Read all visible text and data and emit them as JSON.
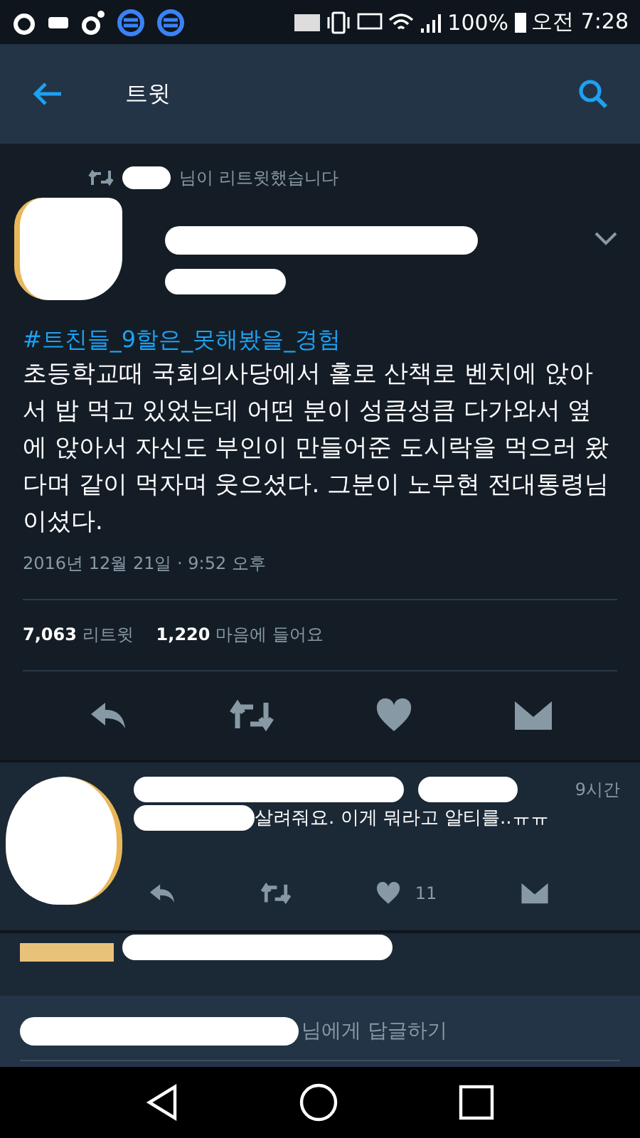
{
  "status_bar": {
    "battery": "100%",
    "time": "오전 7:28"
  },
  "header": {
    "title": "트윗"
  },
  "retweet_notice": "님이 리트윗했습니다",
  "tweet": {
    "hashtag": "#트친들_9할은_못해봤을_경험",
    "text": "초등학교때  국회의사당에서  홀로  산책로 벤치에 앉아서 밥 먹고 있었는데 어떤 분이 성큼성큼 다가와서 옆에  앉아서 자신도 부인이 만들어준 도시락을 먹으러 왔다며 같이 먹자며 웃으셨다. 그분이 노무현 전대통령님이셨다.",
    "timestamp": "2016년 12월 21일 · 9:52 오후",
    "retweets": "7,063",
    "retweets_label": "리트윗",
    "likes": "1,220",
    "likes_label": "마음에 들어요"
  },
  "replies": [
    {
      "time": "9시간",
      "text": "살려줘요. 이게 뭐라고 알티를..ㅠㅠ",
      "like_count": "11"
    }
  ],
  "reply_field": {
    "placeholder": "님에게 답글하기"
  }
}
